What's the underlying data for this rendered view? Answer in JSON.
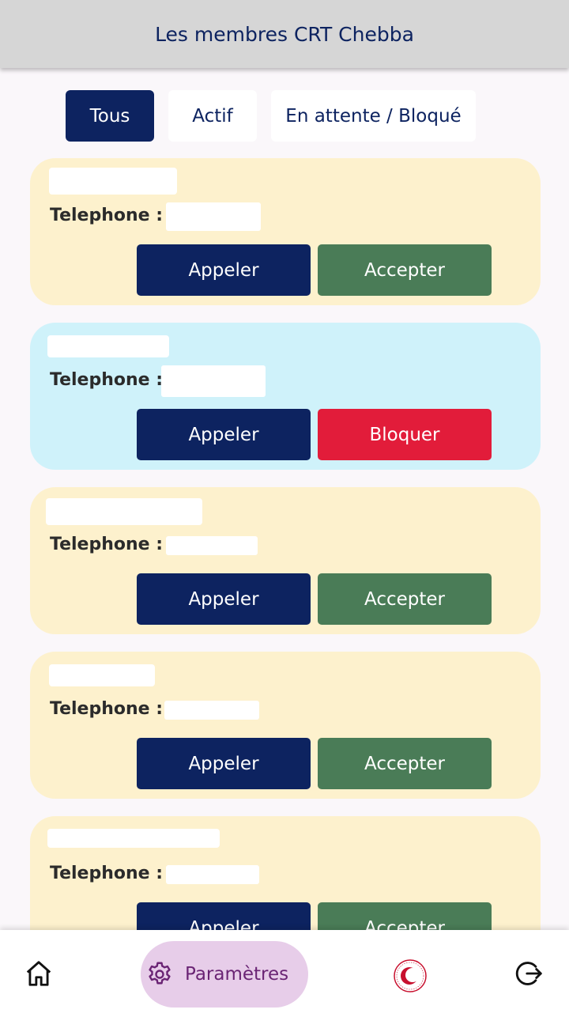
{
  "header": {
    "title": "Les membres CRT Chebba"
  },
  "filters": {
    "all": "Tous",
    "active": "Actif",
    "pending": "En attente / Bloqué"
  },
  "members": [
    {
      "status": "pending",
      "phone_label": "Telephone :",
      "call_label": "Appeler",
      "action_label": "Accepter"
    },
    {
      "status": "active",
      "phone_label": "Telephone :",
      "call_label": "Appeler",
      "action_label": "Bloquer"
    },
    {
      "status": "pending",
      "phone_label": "Telephone :",
      "call_label": "Appeler",
      "action_label": "Accepter"
    },
    {
      "status": "pending",
      "phone_label": "Telephone :",
      "call_label": "Appeler",
      "action_label": "Accepter"
    },
    {
      "status": "pending",
      "phone_label": "Telephone :",
      "call_label": "Appeler",
      "action_label": "Accepter"
    }
  ],
  "bottom_nav": {
    "home_icon": "home-icon",
    "settings_label": "Paramètres",
    "settings_icon": "gear-icon",
    "logo_icon": "red-crescent-logo",
    "logout_icon": "logout-icon"
  },
  "colors": {
    "primary": "#0d2360",
    "accept": "#4a7c57",
    "block": "#e21c3a",
    "pending_card": "#fdf1cd",
    "active_card": "#cff2fa",
    "settings_pill": "#e7cde9"
  }
}
